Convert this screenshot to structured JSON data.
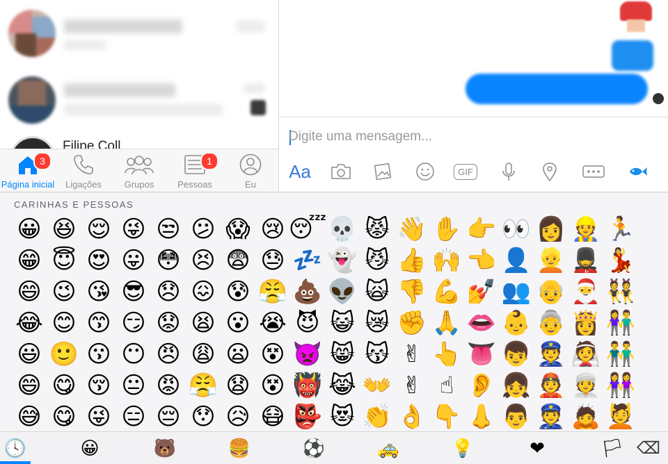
{
  "conversations": [
    {
      "name": "",
      "preview": ""
    },
    {
      "name": "",
      "preview": ""
    },
    {
      "name": "Filipe Coll"
    }
  ],
  "tabs": [
    {
      "label": "Página inicial",
      "icon": "home-icon",
      "badge": "3",
      "active": true
    },
    {
      "label": "Ligações",
      "icon": "phone-icon",
      "badge": "",
      "active": false
    },
    {
      "label": "Grupos",
      "icon": "groups-icon",
      "badge": "",
      "active": false
    },
    {
      "label": "Pessoas",
      "icon": "people-list-icon",
      "badge": "1",
      "active": false
    },
    {
      "label": "Eu",
      "icon": "profile-icon",
      "badge": "",
      "active": false
    }
  ],
  "composer": {
    "placeholder": "Digite uma mensagem...",
    "aa_label": "Aa",
    "gif_label": "GIF"
  },
  "keyboard": {
    "category_title": "CARINHAS E PESSOAS",
    "emoji_rows": [
      [
        "😀",
        "😆",
        "😌",
        "😜",
        "😒",
        "😕",
        "😱",
        "😢",
        "😴",
        "💀",
        "😾",
        "👋",
        "✋",
        "👉",
        "👀",
        "👩",
        "👷",
        "🏃"
      ],
      [
        "😁",
        "😇",
        "😍",
        "😛",
        "😳",
        "😣",
        "😨",
        "😓",
        "💤",
        "👻",
        "😼",
        "👍",
        "🙌",
        "👈",
        "👤",
        "👱",
        "💂",
        "💃"
      ],
      [
        "😄",
        "😉",
        "😘",
        "😎",
        "😞",
        "😖",
        "😰",
        "😤",
        "💩",
        "👽",
        "🙀",
        "👎",
        "💪",
        "💅",
        "👥",
        "👴",
        "🎅",
        "👯"
      ],
      [
        "😂",
        "😊",
        "😙",
        "😏",
        "😟",
        "😫",
        "😮",
        "😭",
        "😈",
        "😺",
        "😿",
        "✊",
        "🙏",
        "👄",
        "👶",
        "👵",
        "👸",
        "👫"
      ],
      [
        "😃",
        "🙂",
        "😗",
        "😶",
        "😠",
        "😩",
        "😦",
        "😵",
        "👿",
        "😸",
        "😽",
        "✌",
        "👆",
        "👅",
        "👦",
        "👮",
        "👰",
        "👬"
      ],
      [
        "😄",
        "😋",
        "😚",
        "😐",
        "😡",
        "😤",
        "😧",
        "😵",
        "👹",
        "😹",
        "👐",
        "✌",
        "☝",
        "👂",
        "👧",
        "👲",
        "👳",
        "👭"
      ],
      [
        "😅",
        "😋",
        "😜",
        "😑",
        "😔",
        "😯",
        "😥",
        "😷",
        "👺",
        "😻",
        "👏",
        "👌",
        "👇",
        "👃",
        "👨",
        "👮",
        "🙇",
        "💆"
      ]
    ],
    "categories": [
      {
        "icon": "clock-icon",
        "glyph": "🕓"
      },
      {
        "icon": "smiley-icon",
        "glyph": "😀"
      },
      {
        "icon": "bear-icon",
        "glyph": "🐻"
      },
      {
        "icon": "burger-icon",
        "glyph": "🍔"
      },
      {
        "icon": "soccer-ball-icon",
        "glyph": "⚽"
      },
      {
        "icon": "taxi-icon",
        "glyph": "🚕"
      },
      {
        "icon": "lightbulb-icon",
        "glyph": "💡"
      },
      {
        "icon": "heart-icon",
        "glyph": "❤"
      },
      {
        "icon": "flag-icon",
        "glyph": "🏳"
      },
      {
        "icon": "backspace-icon",
        "glyph": "⌫"
      }
    ]
  },
  "colors": {
    "accent": "#0084ff",
    "badge": "#ff3b30",
    "bubble": "#0a84ff"
  }
}
